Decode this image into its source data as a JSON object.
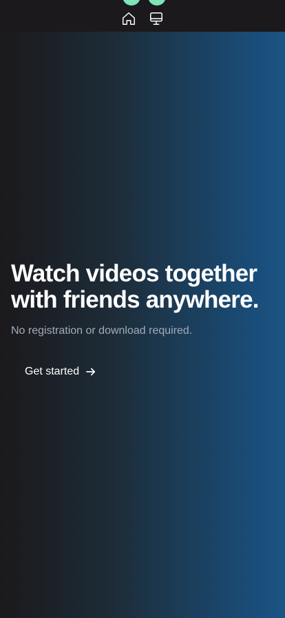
{
  "nav": {
    "home_icon": "home-icon",
    "screen_icon": "monitor-icon"
  },
  "hero": {
    "headline": "Watch videos together with friends anywhere.",
    "subtext": "No registration or download required.",
    "cta_label": "Get started",
    "cta_icon": "arrow-right-icon"
  },
  "colors": {
    "background": "#1b191c",
    "gradient_end": "#1b5485",
    "logo_accent": "#7fe3b8",
    "subtext": "#a3acb8"
  }
}
